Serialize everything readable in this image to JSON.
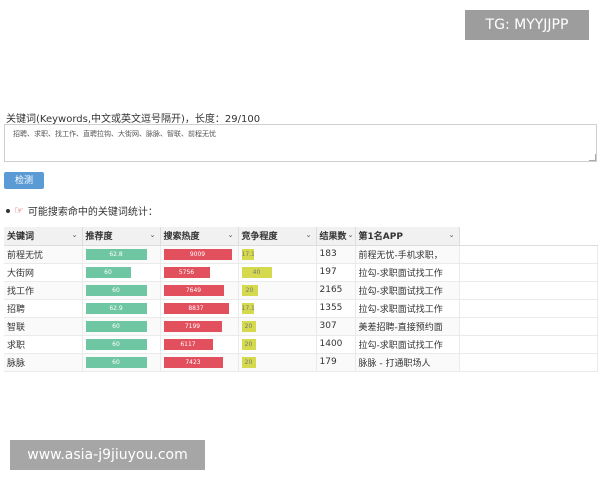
{
  "badge": "TG: MYYJJPP",
  "watermark": "www.asia-j9jiuyou.com",
  "keywords": {
    "label": "关键词(Keywords,中文或英文逗号隔开)，长度：29/100",
    "value": "招聘、求职、找工作、直聘拉钩、大街网、脉脉、智联、前程无忧"
  },
  "check_button": "检测",
  "stats_title": "可能搜索命中的关键词统计：",
  "table": {
    "headers": [
      "关键词",
      "推荐度",
      "搜索热度",
      "竞争程度",
      "结果数",
      "第1名APP"
    ],
    "rows": [
      {
        "keyword": "前程无忧",
        "recommend": "62.8",
        "recommend_pct": 0.85,
        "heat": "9009",
        "heat_pct": 0.94,
        "competition": "17.1",
        "competition_pct": 0.17,
        "results": "183",
        "app": "前程无忧-手机求职，"
      },
      {
        "keyword": "大街网",
        "recommend": "60",
        "recommend_pct": 0.62,
        "heat": "5756",
        "heat_pct": 0.64,
        "competition": "40",
        "competition_pct": 0.42,
        "results": "197",
        "app": "拉勾-求职面试找工作"
      },
      {
        "keyword": "找工作",
        "recommend": "60",
        "recommend_pct": 0.85,
        "heat": "7649",
        "heat_pct": 0.84,
        "competition": "20",
        "competition_pct": 0.22,
        "results": "2165",
        "app": "拉勾-求职面试找工作"
      },
      {
        "keyword": "招聘",
        "recommend": "62.9",
        "recommend_pct": 0.85,
        "heat": "8837",
        "heat_pct": 0.9,
        "competition": "17.1",
        "competition_pct": 0.17,
        "results": "1355",
        "app": "拉勾-求职面试找工作"
      },
      {
        "keyword": "智联",
        "recommend": "60",
        "recommend_pct": 0.85,
        "heat": "7199",
        "heat_pct": 0.8,
        "competition": "20",
        "competition_pct": 0.2,
        "results": "307",
        "app": "美差招聘-直接预约面"
      },
      {
        "keyword": "求职",
        "recommend": "60",
        "recommend_pct": 0.85,
        "heat": "6117",
        "heat_pct": 0.68,
        "competition": "20",
        "competition_pct": 0.2,
        "results": "1400",
        "app": "拉勾-求职面试找工作"
      },
      {
        "keyword": "脉脉",
        "recommend": "60",
        "recommend_pct": 0.85,
        "heat": "7423",
        "heat_pct": 0.82,
        "competition": "20",
        "competition_pct": 0.2,
        "results": "179",
        "app": "脉脉 - 打通职场人"
      }
    ]
  },
  "colors": {
    "recommend": "#6fc6a3",
    "heat": "#e24f5d",
    "competition": "#d4d94d",
    "button": "#5b9bd5",
    "hand_icon": "#d83b2e"
  },
  "icons": {
    "hand": "pointing-hand-icon",
    "sort": "chevron-down-icon"
  }
}
